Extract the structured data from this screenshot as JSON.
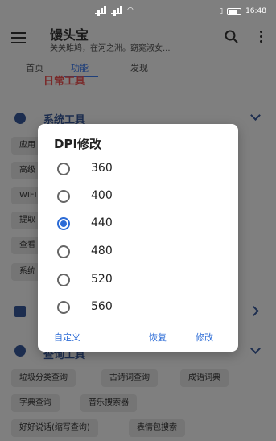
{
  "status_bar": {
    "time": "16:48"
  },
  "app_bar": {
    "title": "馒头宝",
    "subtitle": "关关雎鸠，在河之洲。窈窕淑女..."
  },
  "tabs": [
    {
      "label": "首页",
      "active": false
    },
    {
      "label": "功能",
      "active": true
    },
    {
      "label": "发现",
      "active": false
    }
  ],
  "background": {
    "sections": [
      {
        "title": "日常工具"
      },
      {
        "title": "系统工具"
      },
      {
        "title": "查询工具"
      }
    ],
    "system_chips_partial": [
      "应用",
      "高级",
      "WIFI",
      "提取",
      "查看",
      "系统"
    ],
    "query_chips": [
      "垃圾分类查询",
      "古诗词查询",
      "成语词典",
      "字典查询",
      "音乐搜索器",
      "好好说话(缩写查询)",
      "表情包搜索"
    ]
  },
  "dialog": {
    "title": "DPI修改",
    "options": [
      {
        "label": "360",
        "checked": false
      },
      {
        "label": "400",
        "checked": false
      },
      {
        "label": "440",
        "checked": true
      },
      {
        "label": "480",
        "checked": false
      },
      {
        "label": "520",
        "checked": false
      },
      {
        "label": "560",
        "checked": false
      }
    ],
    "custom_label": "自定义",
    "restore_label": "恢复",
    "modify_label": "修改"
  },
  "colors": {
    "accent": "#2b6bd6",
    "scrim": "#7f7f7f",
    "section": "#1c2d4f"
  }
}
